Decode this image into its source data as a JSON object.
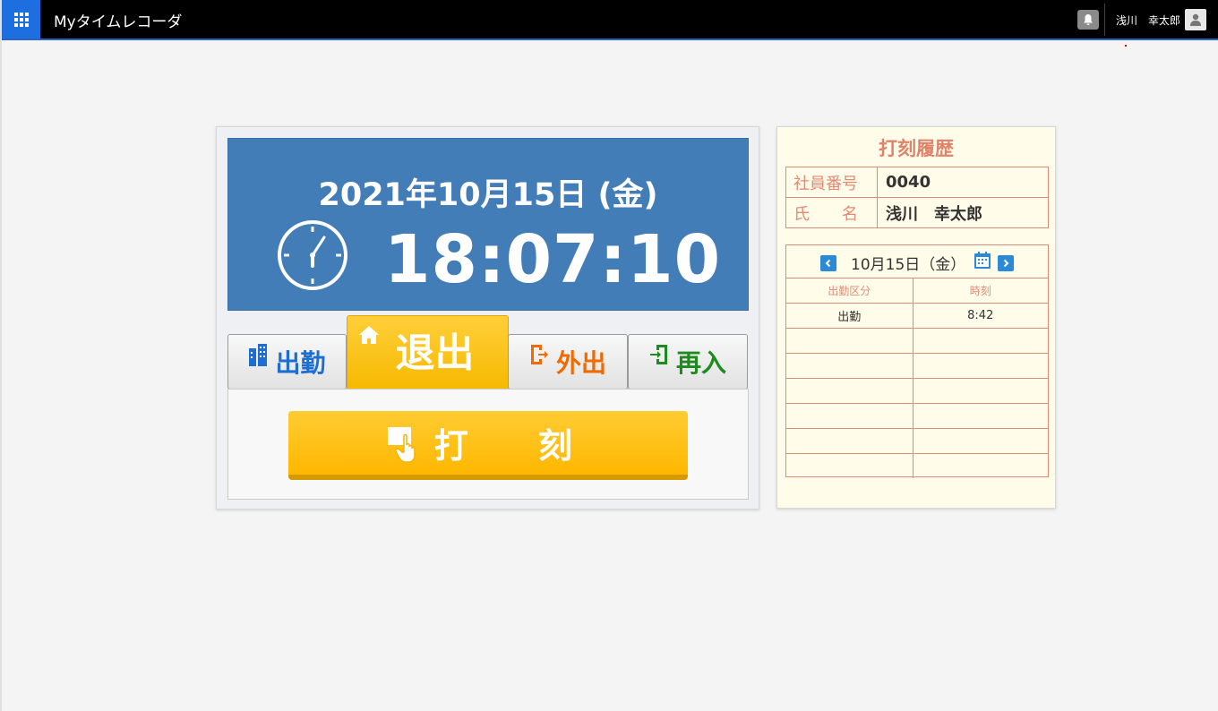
{
  "app": {
    "title": "Myタイムレコーダ"
  },
  "header": {
    "user_name": "浅川　幸太郎"
  },
  "clock": {
    "date": "2021年10月15日 (金)",
    "time": "18:07:10"
  },
  "modes": [
    {
      "label": "出勤",
      "icon": "building-icon",
      "color": "#1e6ed1"
    },
    {
      "label": "退出",
      "icon": "home-icon",
      "color": "#ffffff",
      "selected": true
    },
    {
      "label": "外出",
      "icon": "exit-door-icon",
      "color": "#ef6a00"
    },
    {
      "label": "再入",
      "icon": "enter-door-icon",
      "color": "#1f8a1f"
    }
  ],
  "stamp_button": {
    "label": "打　刻"
  },
  "history": {
    "title": "打刻履歴",
    "employee_no_label": "社員番号",
    "employee_no": "0040",
    "name_label": "氏　　名",
    "name": "浅川　幸太郎",
    "date": "10月15日（金）",
    "col_type": "出勤区分",
    "col_time": "時刻",
    "rows": [
      {
        "type": "出勤",
        "time": "8:42"
      },
      {
        "type": "",
        "time": ""
      },
      {
        "type": "",
        "time": ""
      },
      {
        "type": "",
        "time": ""
      },
      {
        "type": "",
        "time": ""
      },
      {
        "type": "",
        "time": ""
      },
      {
        "type": "",
        "time": ""
      }
    ]
  },
  "colors": {
    "accent": "#437db8",
    "highlight": "#ffbe14",
    "history_border": "#e08c78"
  }
}
